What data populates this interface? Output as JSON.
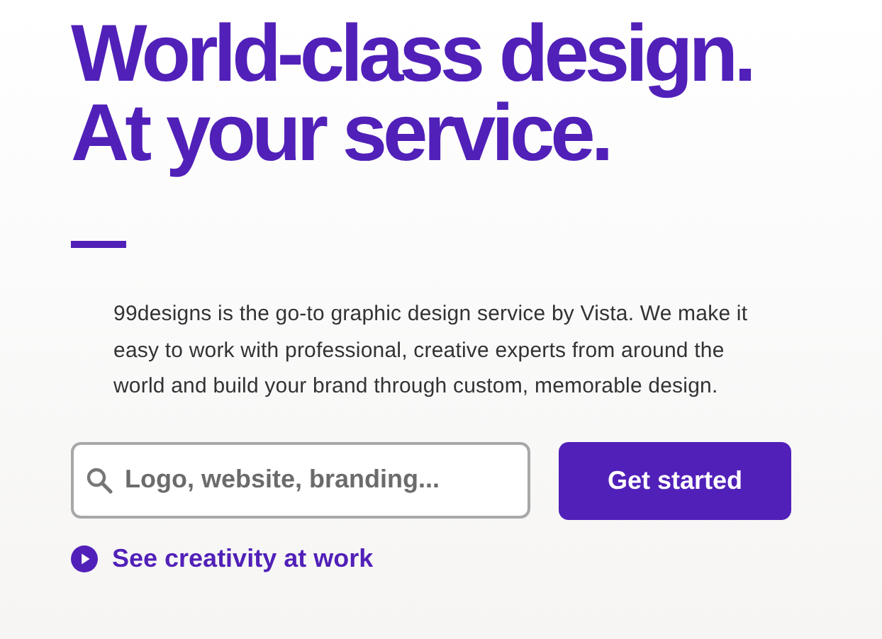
{
  "headline": [
    "World-class design.",
    "At your service."
  ],
  "description": "99designs is the go-to graphic design service by Vista. We make it easy to work with professional, creative experts from around the world and build your brand through custom, memorable design.",
  "search": {
    "placeholder": "Logo, website, branding..."
  },
  "cta_button": "Get started",
  "video_link": "See creativity at work"
}
